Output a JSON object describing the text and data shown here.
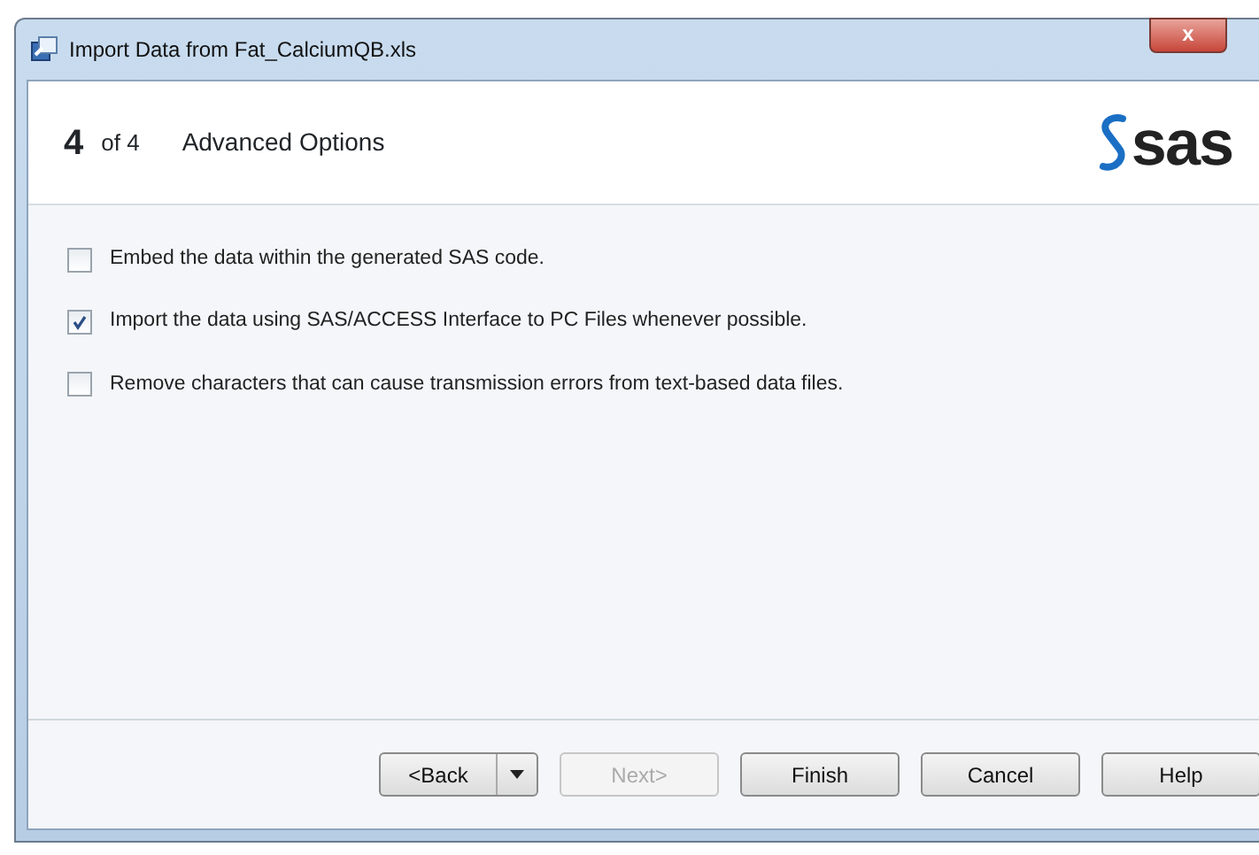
{
  "window": {
    "title": "Import Data from Fat_CalciumQB.xls",
    "close": "x"
  },
  "header": {
    "step": "4",
    "of": "of 4",
    "title": "Advanced Options",
    "logo": "sas"
  },
  "options": [
    {
      "label": "Embed the data within the generated SAS code.",
      "checked": false
    },
    {
      "label": "Import the data using SAS/ACCESS Interface to PC Files whenever possible.",
      "checked": true
    },
    {
      "label": "Remove characters that can cause transmission errors from text-based data files.",
      "checked": false
    }
  ],
  "buttons": [
    {
      "label": "<Back",
      "kind": "split",
      "disabled": false
    },
    {
      "label": "Next>",
      "kind": "plain",
      "disabled": true
    },
    {
      "label": "Finish",
      "kind": "plain",
      "disabled": false
    },
    {
      "label": "Cancel",
      "kind": "plain",
      "disabled": false
    },
    {
      "label": "Help",
      "kind": "plain",
      "disabled": false
    }
  ]
}
